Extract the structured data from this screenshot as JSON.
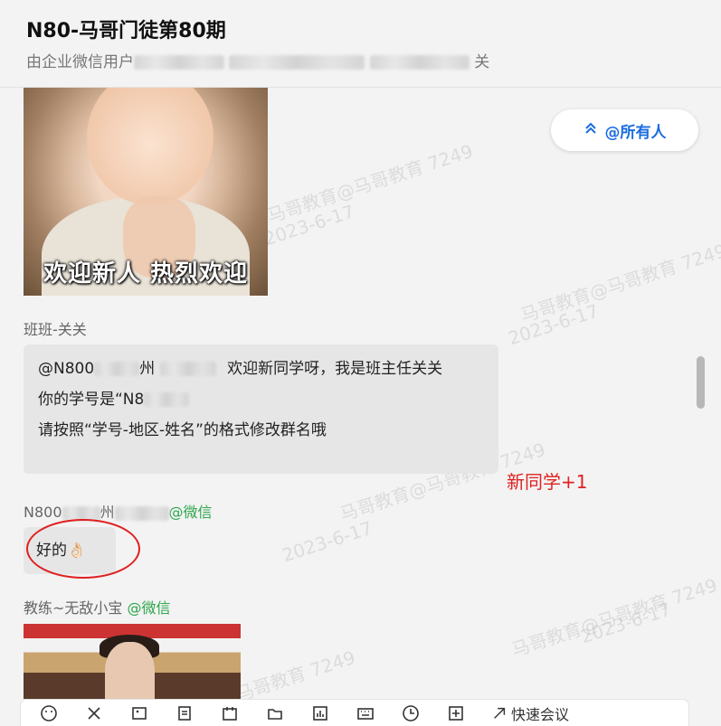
{
  "header": {
    "title": "N80-马哥门徒第80期",
    "subtitle_prefix": "由企业微信用户",
    "subtitle_suffix": "关"
  },
  "messages": {
    "m1": {
      "image_caption": "欢迎新人 热烈欢迎"
    },
    "m2": {
      "sender": "班班-关关",
      "line1_prefix": "@N800",
      "line1_mid": "州",
      "line1_suffix": "欢迎新同学呀，我是班主任关关",
      "line2_prefix": "你的学号是“N8",
      "line3": "请按照“学号-地区-姓名”的格式修改群名哦"
    },
    "m3": {
      "sender_prefix": "N800",
      "sender_mid": "州",
      "sender_suffix": "@微信",
      "text": "好的👌🏻"
    },
    "m4": {
      "sender_name": "教练~无敌小宝",
      "sender_suffix": "@微信"
    }
  },
  "at_all_button": {
    "label": "@所有人",
    "icon": "double-chevron-up-icon"
  },
  "annotation": {
    "note": "新同学+1",
    "color": "#e02020"
  },
  "watermarks": [
    "马哥教育@马哥教育 7249",
    "2023-6-17"
  ],
  "toolbar": {
    "icons": [
      "emoji-icon",
      "scissors-icon",
      "image-icon",
      "document-icon",
      "calendar-icon",
      "folder-icon",
      "chart-icon",
      "keyboard-icon",
      "clock-icon",
      "plus-icon"
    ],
    "quick_meeting": "快速会议"
  },
  "colors": {
    "accent": "#1a6ce0",
    "wechat_green": "#2ca64a",
    "bubble": "#e6e6e6"
  }
}
